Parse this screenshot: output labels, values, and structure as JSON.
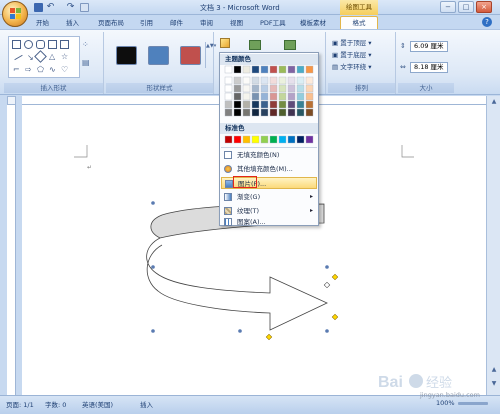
{
  "window": {
    "title": "文档 3 - Microsoft Word",
    "contextual_tab_group": "绘图工具"
  },
  "tabs": [
    "开始",
    "插入",
    "页面布局",
    "引用",
    "邮件",
    "审阅",
    "视图",
    "PDF工具",
    "模板素材",
    "格式"
  ],
  "ribbon": {
    "groups": {
      "insert_shapes": "插入形状",
      "shape_styles": "形状样式",
      "arrange": "排列",
      "size": "大小"
    },
    "arrange_buttons": [
      "置于顶层",
      "置于底层",
      "文字环绕"
    ],
    "size": {
      "height": "6.09 厘米",
      "width": "8.18 厘米"
    },
    "style_swatch_colors": [
      "#0d0d0d",
      "#4f81bd",
      "#c0504d"
    ]
  },
  "fill_menu": {
    "theme_colors_label": "主题颜色",
    "standard_colors_label": "标准色",
    "theme_colors": [
      "#ffffff",
      "#000000",
      "#eeece1",
      "#1f497d",
      "#4f81bd",
      "#c0504d",
      "#9bbb59",
      "#8064a2",
      "#4bacc6",
      "#f79646"
    ],
    "standard_colors": [
      "#c00000",
      "#ff0000",
      "#ffc000",
      "#ffff00",
      "#92d050",
      "#00b050",
      "#00b0f0",
      "#0070c0",
      "#002060",
      "#7030a0"
    ],
    "items": [
      "无填充颜色(N)",
      "其他填充颜色(M)...",
      "图片(P)...",
      "渐变(G)",
      "纹理(T)",
      "图案(A)..."
    ]
  },
  "statusbar": {
    "page": "页面: 1/1",
    "words": "字数: 0",
    "language": "英语(美国)",
    "mode": "插入",
    "zoom": "100%"
  },
  "watermark": {
    "url": "jingyan.baidu.com"
  }
}
